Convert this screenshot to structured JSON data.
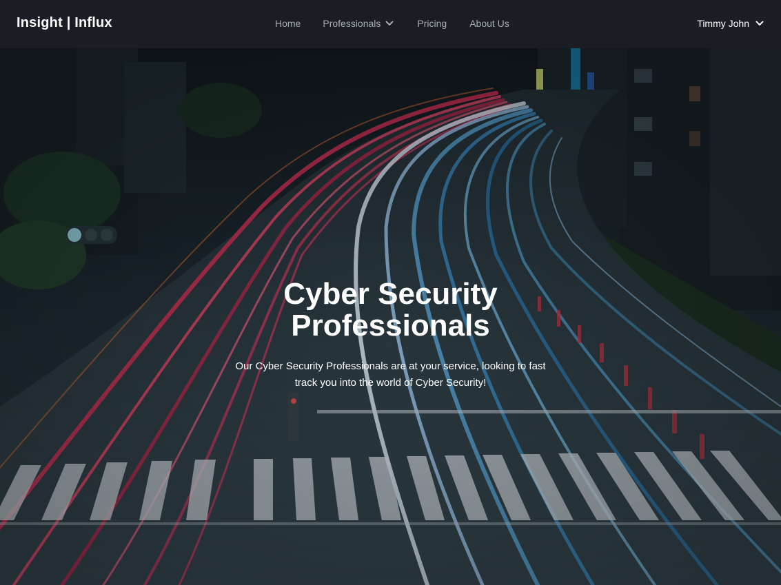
{
  "brand": "Insight | Influx",
  "nav": {
    "home": "Home",
    "professionals": "Professionals",
    "pricing": "Pricing",
    "about": "About Us"
  },
  "user": {
    "name": "Timmy John"
  },
  "hero": {
    "title": "Cyber Security Professionals",
    "text": "Our Cyber Security Professionals are at your service, looking to fast track you into the world of Cyber Security!",
    "background": "night-city-light-trails-image"
  },
  "colors": {
    "navbar": "#1a1e24",
    "nav_link": "#a7adb4",
    "text": "#ffffff"
  }
}
